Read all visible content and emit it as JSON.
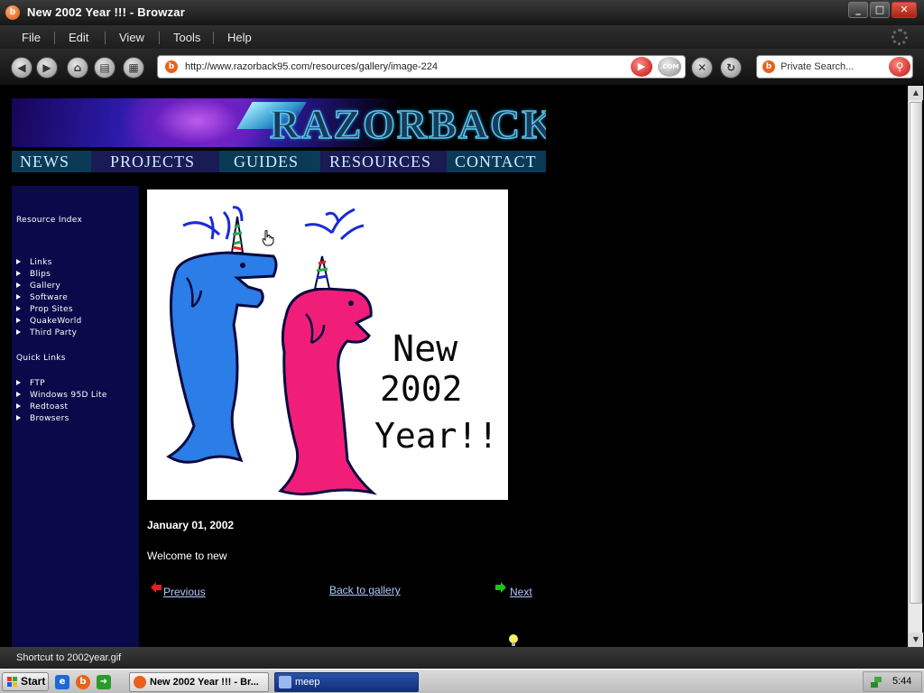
{
  "window": {
    "title": "New 2002 Year !!! - Browzar",
    "app_icon_letter": "b"
  },
  "menu": {
    "items": [
      "File",
      "Edit",
      "View",
      "Tools",
      "Help"
    ]
  },
  "toolbar": {
    "url": "http://www.razorback95.com/resources/gallery/image-224",
    "com_label": ".COM",
    "search_placeholder": "Private Search..."
  },
  "site": {
    "logo": "RAZORBACK",
    "nav": [
      "NEWS",
      "PROJECTS",
      "GUIDES",
      "RESOURCES",
      "CONTACT"
    ]
  },
  "sidebar": {
    "resource_heading": "Resource Index",
    "resource_items": [
      "Links",
      "Blips",
      "Gallery",
      "Software",
      "Prop Sites",
      "QuakeWorld",
      "Third Party"
    ],
    "quick_heading": "Quick Links",
    "quick_items": [
      "FTP",
      "Windows 95D Lite",
      "Redtoast",
      "Browsers"
    ]
  },
  "artwork": {
    "line1": "New",
    "line2": "2002",
    "line3": "Year!!"
  },
  "content": {
    "date": "January 01, 2002",
    "text": "Welcome to new",
    "previous_label": "Previous",
    "back_label": "Back to gallery",
    "next_label": "Next"
  },
  "statusbar": {
    "text": "Shortcut to 2002year.gif"
  },
  "taskbar": {
    "start_label": "Start",
    "active_task": "New 2002 Year !!! - Br...",
    "other_task": "meep",
    "clock": "5:44"
  },
  "colors": {
    "link": "#b0c8ff",
    "sidebar_bg": "#0a0a4a",
    "nav_bg": "#0a3a55"
  }
}
